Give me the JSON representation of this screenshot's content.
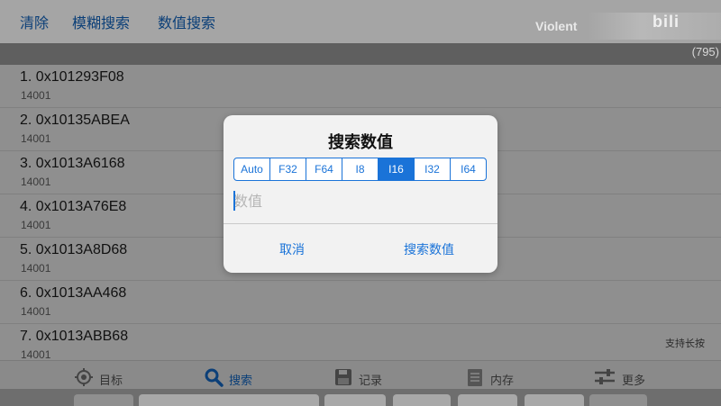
{
  "toolbar": {
    "clear_label": "清除",
    "fuzzy_search_label": "模糊搜索",
    "value_search_label": "数值搜索",
    "brand_text": "Violent",
    "logo_text": "bili"
  },
  "result_count": "(795)",
  "results": [
    {
      "address": "1. 0x101293F08",
      "value": "14001"
    },
    {
      "address": "2. 0x10135ABEA",
      "value": "14001"
    },
    {
      "address": "3. 0x1013A6168",
      "value": "14001"
    },
    {
      "address": "4. 0x1013A76E8",
      "value": "14001"
    },
    {
      "address": "5. 0x1013A8D68",
      "value": "14001"
    },
    {
      "address": "6. 0x1013AA468",
      "value": "14001"
    },
    {
      "address": "7. 0x1013ABB68",
      "value": "14001"
    }
  ],
  "long_press_hint": "支持长按",
  "dialog": {
    "title": "搜索数值",
    "types": [
      "Auto",
      "F32",
      "F64",
      "I8",
      "I16",
      "I32",
      "I64"
    ],
    "selected_type": "I16",
    "input_placeholder": "数值",
    "input_value": "",
    "cancel_label": "取消",
    "confirm_label": "搜索数值"
  },
  "tabs": [
    {
      "label": "目标",
      "icon": "target-icon",
      "active": false
    },
    {
      "label": "搜索",
      "icon": "search-icon",
      "active": true
    },
    {
      "label": "记录",
      "icon": "save-icon",
      "active": false
    },
    {
      "label": "内存",
      "icon": "memory-icon",
      "active": false
    },
    {
      "label": "更多",
      "icon": "sliders-icon",
      "active": false
    }
  ],
  "colors": {
    "accent": "#1a73d8",
    "toolbar_text": "#0b3f78",
    "overlay_background": "#8f8f8f",
    "dialog_background": "#f2f2f2"
  }
}
